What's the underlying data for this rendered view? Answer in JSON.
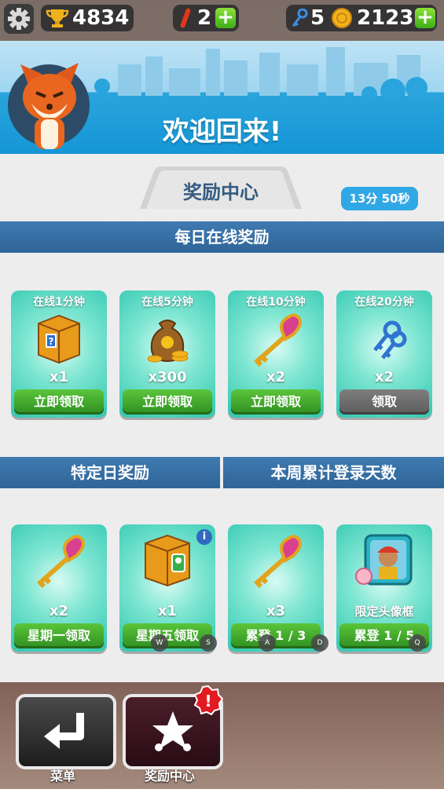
{
  "topbar": {
    "trophies": "4834",
    "boards": "2",
    "keys": "5",
    "coins": "2123"
  },
  "header": {
    "welcome": "欢迎回来!"
  },
  "tab_title": "奖励中心",
  "daily": {
    "title": "每日在线奖励",
    "timer": "13分 50秒",
    "cards": [
      {
        "caption": "在线1分钟",
        "icon": "mystery-box-icon",
        "qty": "x1",
        "button": "立即领取",
        "enabled": true
      },
      {
        "caption": "在线5分钟",
        "icon": "coin-bag-icon",
        "qty": "x300",
        "button": "立即领取",
        "enabled": true
      },
      {
        "caption": "在线10分钟",
        "icon": "heart-key-icon",
        "qty": "x2",
        "button": "立即领取",
        "enabled": true
      },
      {
        "caption": "在线20分钟",
        "icon": "keys-icon",
        "qty": "x2",
        "button": "领取",
        "enabled": false
      }
    ]
  },
  "special": {
    "title": "特定日奖励"
  },
  "weekly": {
    "title": "本周累计登录天数"
  },
  "bottom_cards": [
    {
      "icon": "heart-key-icon",
      "qty": "x2",
      "button": "星期一领取"
    },
    {
      "icon": "character-box-icon",
      "qty": "x1",
      "button": "星期五领取"
    },
    {
      "icon": "heart-key-icon",
      "qty": "x3",
      "button": "累登 1 / 3"
    },
    {
      "icon": "avatar-frame-icon",
      "qty": "限定头像框",
      "button": "累登 1 / 5"
    }
  ],
  "key_hints": [
    "W",
    "S",
    "A",
    "D",
    "Q"
  ],
  "nav": {
    "menu": "菜单",
    "rewards": "奖励中心"
  },
  "colors": {
    "green": "#3fae17",
    "blue": "#1596d5",
    "teal": "#2fc7b0",
    "section": "#2f6598"
  }
}
